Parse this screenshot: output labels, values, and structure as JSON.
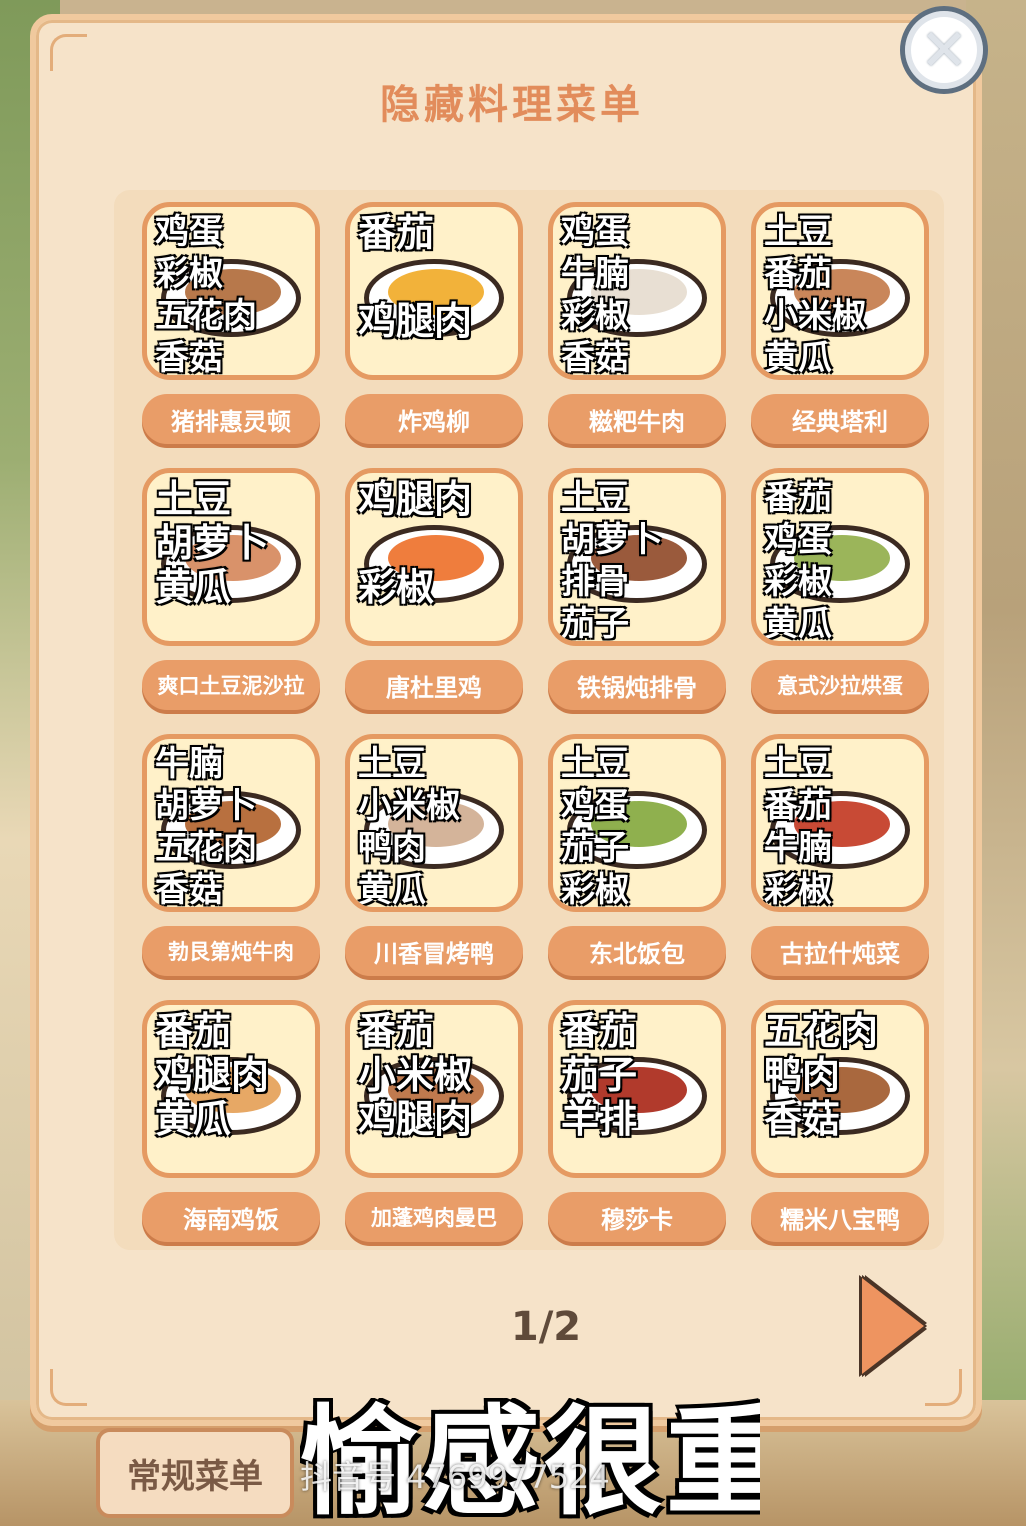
{
  "dialog": {
    "title": "隐藏料理菜单",
    "close_icon": "close-icon"
  },
  "recipes": [
    {
      "name": "猪排惠灵顿",
      "ingredients": [
        "鸡蛋",
        "彩椒",
        "五花肉",
        "香菇"
      ],
      "food_color": "#b7784b"
    },
    {
      "name": "炸鸡柳",
      "ingredients": [
        "番茄",
        "",
        "鸡腿肉"
      ],
      "food_color": "#f2b23a"
    },
    {
      "name": "糍粑牛肉",
      "ingredients": [
        "鸡蛋",
        "牛腩",
        "彩椒",
        "香菇"
      ],
      "food_color": "#e8dfd3"
    },
    {
      "name": "经典塔利",
      "ingredients": [
        "土豆",
        "番茄",
        "小米椒",
        "黄瓜"
      ],
      "food_color": "#c9865a"
    },
    {
      "name": "爽口土豆泥沙拉",
      "ingredients": [
        "土豆",
        "胡萝卜",
        "黄瓜"
      ],
      "food_color": "#d9926a"
    },
    {
      "name": "唐杜里鸡",
      "ingredients": [
        "鸡腿肉",
        "",
        "彩椒"
      ],
      "food_color": "#ef7d3d"
    },
    {
      "name": "铁锅炖排骨",
      "ingredients": [
        "土豆",
        "胡萝卜",
        "排骨",
        "茄子"
      ],
      "food_color": "#9a5a3c"
    },
    {
      "name": "意式沙拉烘蛋",
      "ingredients": [
        "番茄",
        "鸡蛋",
        "彩椒",
        "黄瓜"
      ],
      "food_color": "#9bb55a"
    },
    {
      "name": "勃艮第炖牛肉",
      "ingredients": [
        "牛腩",
        "胡萝卜",
        "五花肉",
        "香菇"
      ],
      "food_color": "#b8703f"
    },
    {
      "name": "川香冒烤鸭",
      "ingredients": [
        "土豆",
        "小米椒",
        "鸭肉",
        "黄瓜"
      ],
      "food_color": "#d4b49a"
    },
    {
      "name": "东北饭包",
      "ingredients": [
        "土豆",
        "鸡蛋",
        "茄子",
        "彩椒"
      ],
      "food_color": "#8fb04e"
    },
    {
      "name": "古拉什炖菜",
      "ingredients": [
        "土豆",
        "番茄",
        "牛腩",
        "彩椒"
      ],
      "food_color": "#c84a35"
    },
    {
      "name": "海南鸡饭",
      "ingredients": [
        "番茄",
        "鸡腿肉",
        "黄瓜"
      ],
      "food_color": "#e7a865"
    },
    {
      "name": "加蓬鸡肉曼巴",
      "ingredients": [
        "番茄",
        "小米椒",
        "鸡腿肉"
      ],
      "food_color": "#c07a4e"
    },
    {
      "name": "穆莎卡",
      "ingredients": [
        "番茄",
        "茄子",
        "羊排"
      ],
      "food_color": "#b13a2c"
    },
    {
      "name": "糯米八宝鸭",
      "ingredients": [
        "五花肉",
        "鸭肉",
        "香菇"
      ],
      "food_color": "#a9683e"
    }
  ],
  "pagination": {
    "indicator": "1/2",
    "next_icon": "play-triangle-icon"
  },
  "bottom": {
    "regular_menu_tab": "常规菜单",
    "overlay_caption": "愉感很重",
    "watermark": "抖音号 4769977524"
  },
  "colors": {
    "accent": "#e99d68",
    "panel": "#f6e3c9",
    "title": "#e28c5b"
  }
}
